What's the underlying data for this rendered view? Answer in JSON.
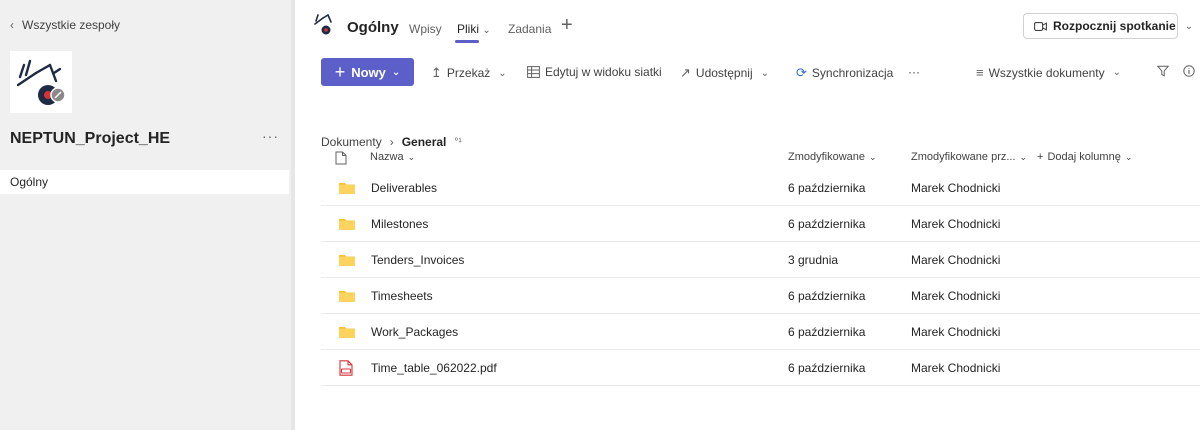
{
  "sidebar": {
    "back_label": "Wszystkie zespoły",
    "team_name": "NEPTUN_Project_HE",
    "more": "···",
    "channel": "Ogólny"
  },
  "header": {
    "channel_title": "Ogólny",
    "tabs": [
      {
        "label": "Wpisy"
      },
      {
        "label": "Pliki"
      },
      {
        "label": "Zadania"
      }
    ],
    "add": "+",
    "meet_label": "Rozpocznij spotkanie"
  },
  "toolbar": {
    "new_label": "Nowy",
    "upload": "Przekaż",
    "grid_edit": "Edytuj w widoku siatki",
    "share": "Udostępnij",
    "sync": "Synchronizacja",
    "more": "···",
    "view": "Wszystkie dokumenty"
  },
  "breadcrumb": {
    "root": "Dokumenty",
    "current": "General"
  },
  "table": {
    "headers": {
      "name": "Nazwa",
      "modified": "Zmodyfikowane",
      "modified_by": "Zmodyfikowane prz...",
      "add_column": "Dodaj kolumnę"
    },
    "rows": [
      {
        "type": "folder",
        "name": "Deliverables",
        "modified": "6 października",
        "by": "Marek Chodnicki"
      },
      {
        "type": "folder",
        "name": "Milestones",
        "modified": "6 października",
        "by": "Marek Chodnicki"
      },
      {
        "type": "folder",
        "name": "Tenders_Invoices",
        "modified": "3 grudnia",
        "by": "Marek Chodnicki"
      },
      {
        "type": "folder",
        "name": "Timesheets",
        "modified": "6 października",
        "by": "Marek Chodnicki"
      },
      {
        "type": "folder",
        "name": "Work_Packages",
        "modified": "6 października",
        "by": "Marek Chodnicki"
      },
      {
        "type": "pdf",
        "name": "Time_table_062022.pdf",
        "modified": "6 października",
        "by": "Marek Chodnicki"
      }
    ]
  },
  "colors": {
    "accent": "#5b5fc7",
    "folder": "#f5c542",
    "pdf": "#d13438"
  }
}
